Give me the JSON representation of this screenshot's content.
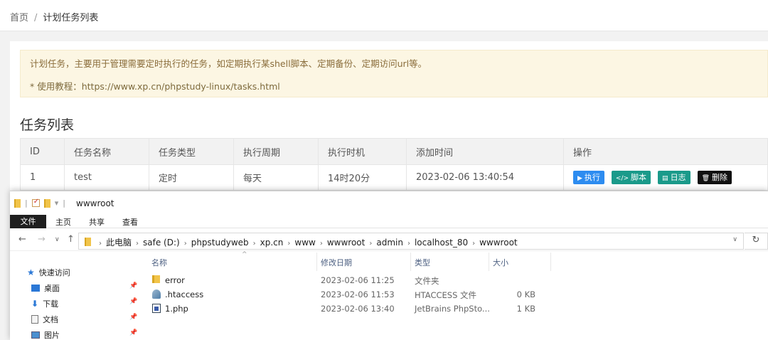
{
  "breadcrumb": {
    "home": "首页",
    "separator": "/",
    "current": "计划任务列表"
  },
  "notice": {
    "line1": "计划任务，主要用于管理需要定时执行的任务，如定期执行某shell脚本、定期备份、定期访问url等。",
    "line2": "* 使用教程：https://www.xp.cn/phpstudy-linux/tasks.html"
  },
  "section_title": "任务列表",
  "table": {
    "headers": [
      "ID",
      "任务名称",
      "任务类型",
      "执行周期",
      "执行时机",
      "添加时间",
      "操作"
    ],
    "rows": [
      {
        "id": "1",
        "name": "test",
        "type": "定时",
        "cycle": "每天",
        "timing": "14时20分",
        "added": "2023-02-06 13:40:54"
      }
    ],
    "actions": {
      "run": "执行",
      "script": "脚本",
      "log": "日志",
      "delete": "删除"
    }
  },
  "explorer": {
    "title": "wwwroot",
    "ribbon_tabs": [
      "文件",
      "主页",
      "共享",
      "查看"
    ],
    "path": [
      "此电脑",
      "safe (D:)",
      "phpstudyweb",
      "xp.cn",
      "www",
      "wwwroot",
      "admin",
      "localhost_80",
      "wwwroot"
    ],
    "sidebar": [
      {
        "label": "快速访问",
        "icon": "star-icon"
      },
      {
        "label": "桌面",
        "icon": "desktop-icon"
      },
      {
        "label": "下载",
        "icon": "download-icon"
      },
      {
        "label": "文档",
        "icon": "document-icon"
      },
      {
        "label": "图片",
        "icon": "picture-icon"
      }
    ],
    "columns": {
      "name": "名称",
      "modified": "修改日期",
      "type": "类型",
      "size": "大小"
    },
    "files": [
      {
        "name": "error",
        "modified": "2023-02-06 11:25",
        "type": "文件夹",
        "size": "",
        "icon": "folder-icon"
      },
      {
        "name": ".htaccess",
        "modified": "2023-02-06 11:53",
        "type": "HTACCESS 文件",
        "size": "0 KB",
        "icon": "file-icon"
      },
      {
        "name": "1.php",
        "modified": "2023-02-06 13:40",
        "type": "JetBrains PhpSto...",
        "size": "1 KB",
        "icon": "php-file-icon"
      }
    ]
  },
  "colors": {
    "run": "#2d8cf0",
    "teal": "#1a9a8a",
    "delete": "#111111",
    "notice_bg": "#fcf6e3",
    "notice_text": "#8a6d3b"
  }
}
